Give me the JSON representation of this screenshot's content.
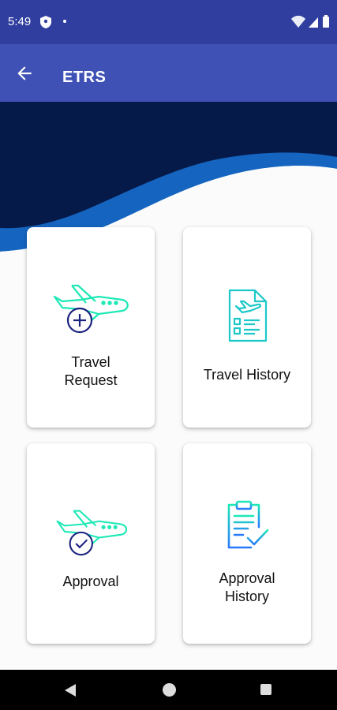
{
  "status_bar": {
    "time": "5:49",
    "icons": [
      "shield-icon",
      "notification-dot-icon",
      "wifi-icon",
      "signal-icon",
      "battery-icon"
    ]
  },
  "app_bar": {
    "title": "ETRS",
    "back_icon": "arrow-back-icon"
  },
  "colors": {
    "status_bar": "#303f9f",
    "app_bar": "#3f51b5",
    "header_dark": "#061a4a",
    "wave_accent": "#1565c0",
    "icon_teal": "#1de9b6",
    "icon_blue": "#1a237e"
  },
  "menu": [
    {
      "label": "Travel\nRequest",
      "icon": "plane-add-icon"
    },
    {
      "label": "Travel History",
      "icon": "travel-document-icon"
    },
    {
      "label": "Approval",
      "icon": "plane-check-icon"
    },
    {
      "label": "Approval\nHistory",
      "icon": "clipboard-check-icon"
    }
  ],
  "nav_bar": {
    "icons": [
      "nav-back-icon",
      "nav-home-icon",
      "nav-recents-icon"
    ]
  }
}
